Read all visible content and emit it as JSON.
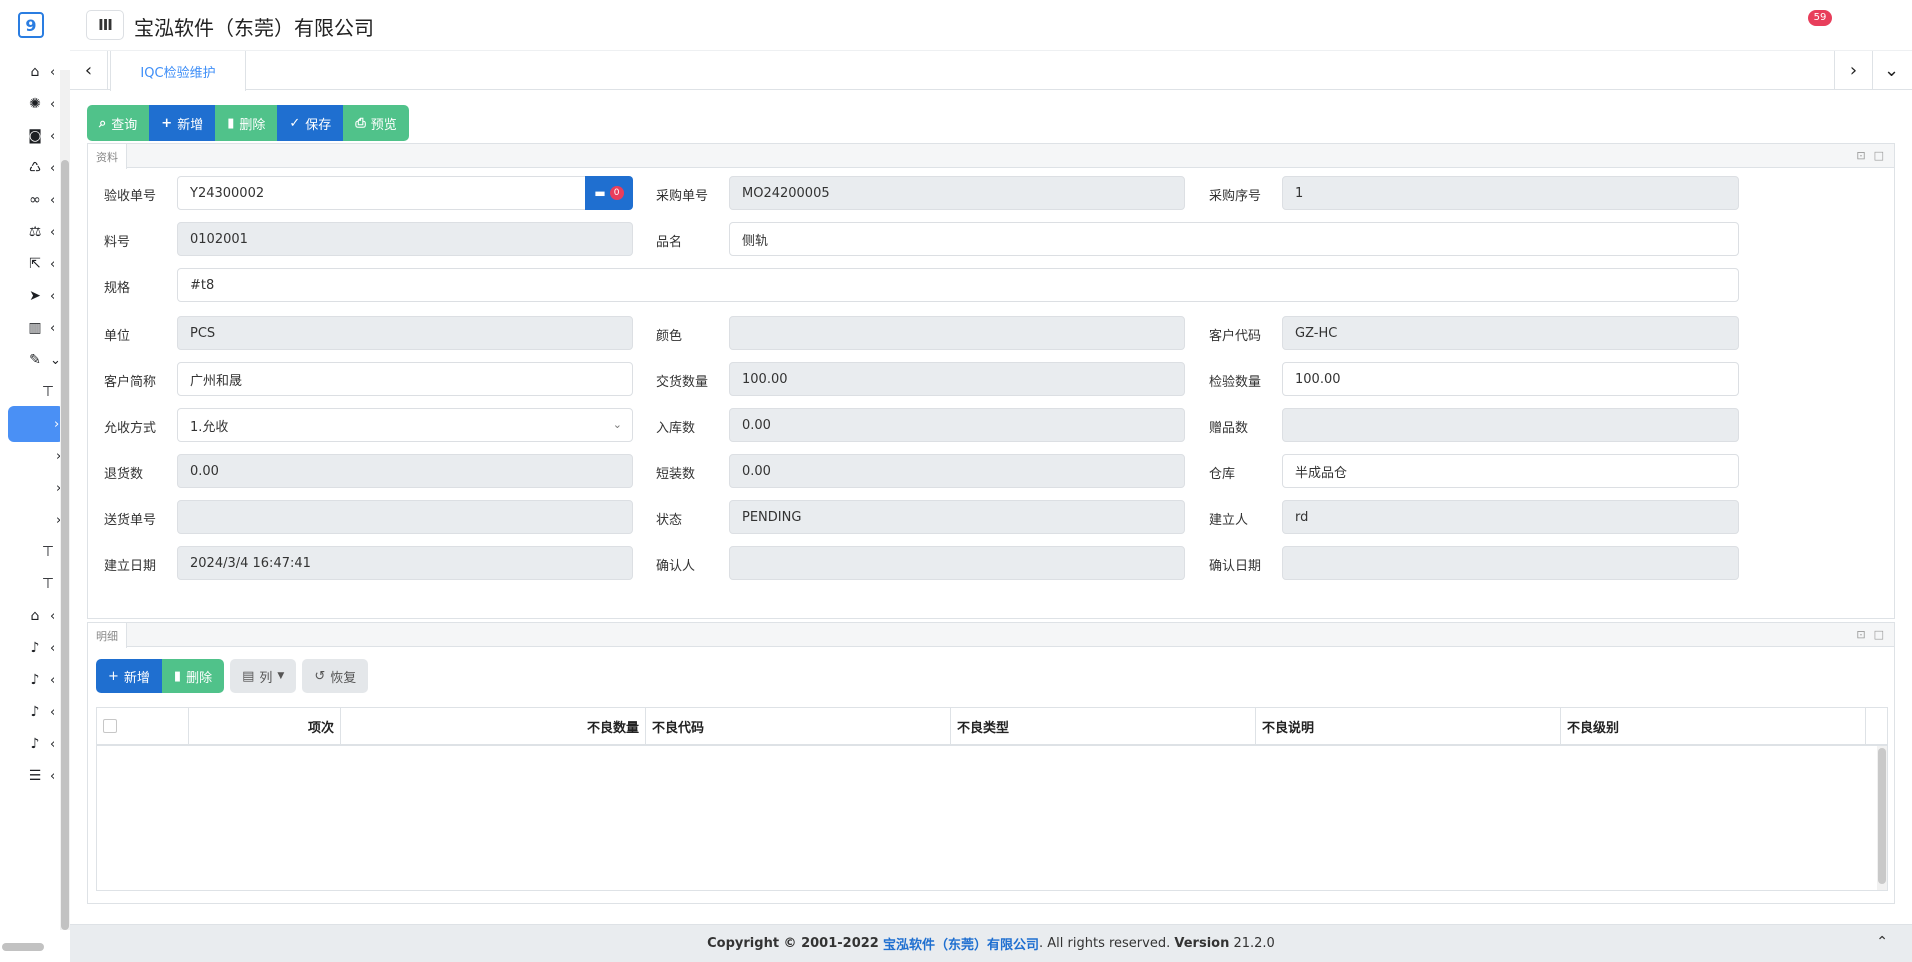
{
  "app": {
    "title": "宝泓软件（东莞）有限公司",
    "menu_toggle": "III",
    "notification_count": "59"
  },
  "tabs": {
    "active": "IQC检验维护"
  },
  "toolbar": {
    "query": "查询",
    "add": "新增",
    "delete": "删除",
    "save": "保存",
    "preview": "预览"
  },
  "form_panel": {
    "title": "资料",
    "fields": {
      "receipt_no": {
        "label": "验收单号",
        "value": "Y24300002",
        "attach_count": "0"
      },
      "po_no": {
        "label": "采购单号",
        "value": "MO24200005"
      },
      "po_seq": {
        "label": "采购序号",
        "value": "1"
      },
      "part_no": {
        "label": "料号",
        "value": "0102001"
      },
      "part_name": {
        "label": "品名",
        "value": "侧轨"
      },
      "spec": {
        "label": "规格",
        "value": "#t8"
      },
      "unit": {
        "label": "单位",
        "value": "PCS"
      },
      "color": {
        "label": "颜色",
        "value": ""
      },
      "customer_code": {
        "label": "客户代码",
        "value": "GZ-HC"
      },
      "customer_short": {
        "label": "客户简称",
        "value": "广州和晟"
      },
      "delivery_qty": {
        "label": "交货数量",
        "value": "100.00"
      },
      "inspect_qty": {
        "label": "检验数量",
        "value": "100.00"
      },
      "accept_method": {
        "label": "允收方式",
        "value": "1.允收"
      },
      "stock_in_qty": {
        "label": "入库数",
        "value": "0.00"
      },
      "gift_qty": {
        "label": "赠品数",
        "value": ""
      },
      "return_qty": {
        "label": "退货数",
        "value": "0.00"
      },
      "short_qty": {
        "label": "短装数",
        "value": "0.00"
      },
      "warehouse": {
        "label": "仓库",
        "value": "半成品仓"
      },
      "delivery_no": {
        "label": "送货单号",
        "value": ""
      },
      "status": {
        "label": "状态",
        "value": "PENDING"
      },
      "created_by": {
        "label": "建立人",
        "value": "rd"
      },
      "created_date": {
        "label": "建立日期",
        "value": "2024/3/4 16:47:41"
      },
      "confirmed_by": {
        "label": "确认人",
        "value": ""
      },
      "confirmed_date": {
        "label": "确认日期",
        "value": ""
      }
    }
  },
  "detail_panel": {
    "title": "明细",
    "toolbar": {
      "add": "新增",
      "delete": "删除",
      "columns": "列",
      "restore": "恢复"
    },
    "columns": [
      "项次",
      "不良数量",
      "不良代码",
      "不良类型",
      "不良说明",
      "不良级别"
    ],
    "rows": []
  },
  "footer": {
    "copyright": "Copyright © 2001-2022",
    "company": "宝泓软件（东莞）有限公司",
    "rights": ". All rights reserved.",
    "version_label": "Version",
    "version": "21.2.0"
  },
  "colors": {
    "primary": "#1f6fd0",
    "success": "#50c28a",
    "accent": "#3e8ef7",
    "danger": "#e83e5b"
  }
}
